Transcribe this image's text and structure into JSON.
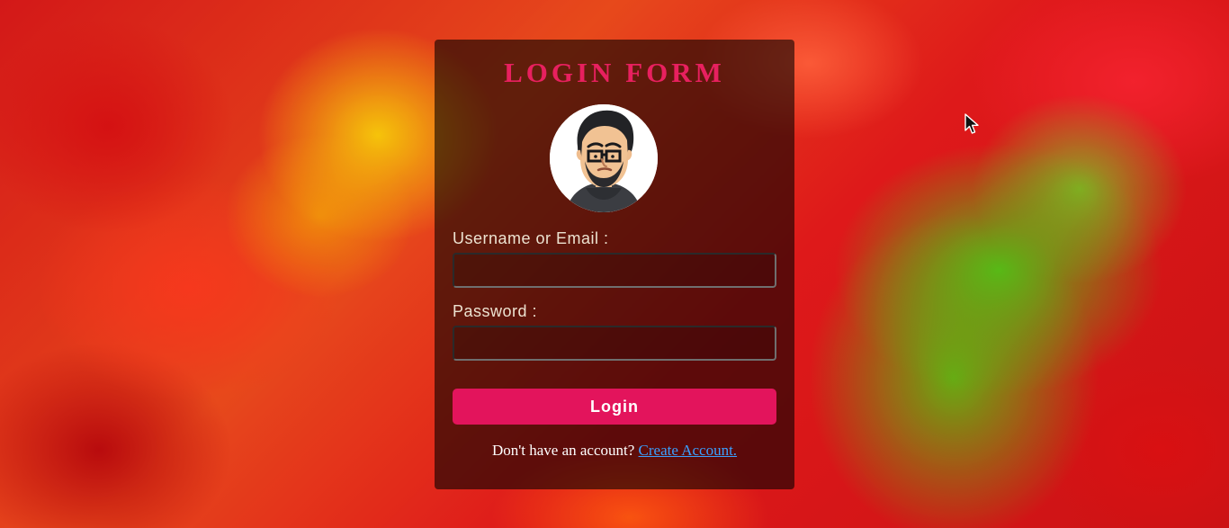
{
  "page": {
    "title": "LOGIN FORM"
  },
  "avatar": {
    "icon": "cartoon-man-avatar"
  },
  "form": {
    "username_label": "Username or Email :",
    "username_value": "",
    "password_label": "Password :",
    "password_value": "",
    "login_button": "Login"
  },
  "footer": {
    "prompt": "Don't have an account?",
    "link": "Create Account."
  },
  "colors": {
    "accent": "#e3145c",
    "title": "#e8205f",
    "link": "#3aa0ff"
  }
}
